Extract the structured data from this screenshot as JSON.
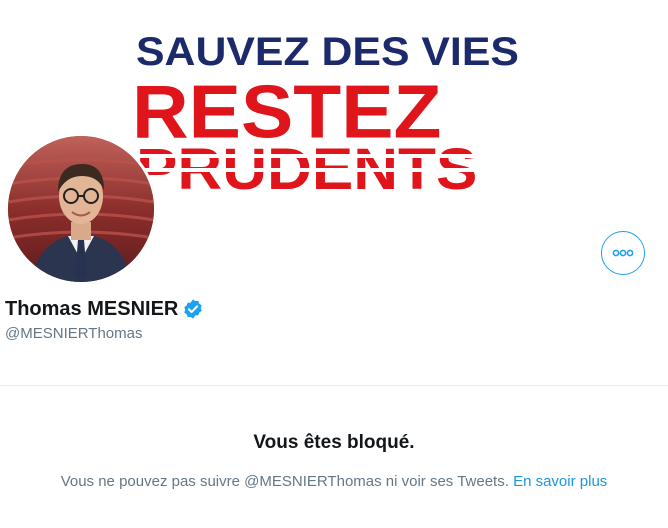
{
  "banner": {
    "line1": "SAUVEZ DES VIES",
    "line2": "RESTEZ",
    "line3": "PRUDENTS"
  },
  "profile": {
    "display_name": "Thomas MESNIER",
    "handle": "@MESNIERThomas",
    "verified": true
  },
  "blocked": {
    "title": "Vous êtes bloqué.",
    "message": "Vous ne pouvez pas suivre @MESNIERThomas ni voir ses Tweets.",
    "learn_more": "En savoir plus"
  },
  "colors": {
    "accent": "#1da1f2",
    "banner_blue": "#1c2a6b",
    "banner_red": "#e0141b",
    "text_primary": "#14171a",
    "text_secondary": "#657786"
  },
  "icons": {
    "more": "more-horizontal-icon",
    "verified": "verified-badge-icon"
  }
}
